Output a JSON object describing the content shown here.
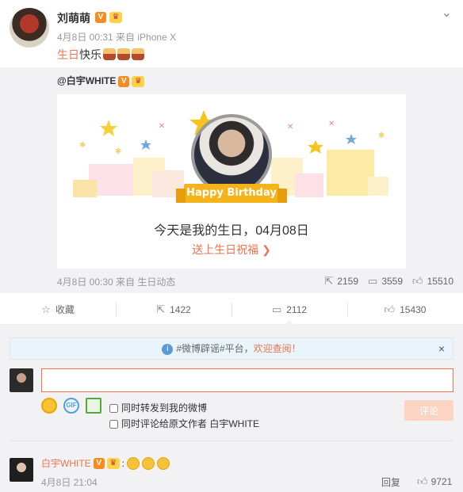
{
  "post": {
    "author": "刘萌萌",
    "time": "4月8日 00:31 来自 iPhone X",
    "text_highlight": "生日",
    "text_rest": "快乐"
  },
  "repost": {
    "author": "@白宇WHITE",
    "card": {
      "ribbon": "Happy Birthday",
      "title": "今天是我的生日，04月08日",
      "link": "送上生日祝福 ❯"
    },
    "meta": "4月8日 00:30 来自 生日动态",
    "stats": {
      "reposts": "2159",
      "comments": "3559",
      "likes": "15510"
    }
  },
  "actions": {
    "favorite": "收藏",
    "repost": "1422",
    "comment": "2112",
    "like": "15430"
  },
  "comment_box": {
    "notice_prefix": "#微博辟谣#平台，",
    "notice_link": "欢迎查阅！",
    "input_value": "",
    "check1": "同时转发到我的微博",
    "check2": "同时评论给原文作者 白宇WHITE",
    "submit": "评论"
  },
  "comments": [
    {
      "author": "白宇WHITE",
      "time": "4月8日 21:04",
      "reply": "回复",
      "likes": "9721"
    }
  ],
  "colors": {
    "accent": "#eb7350",
    "vip_badge": "#f68b1f",
    "gold": "#f4b318",
    "muted": "#999999"
  }
}
